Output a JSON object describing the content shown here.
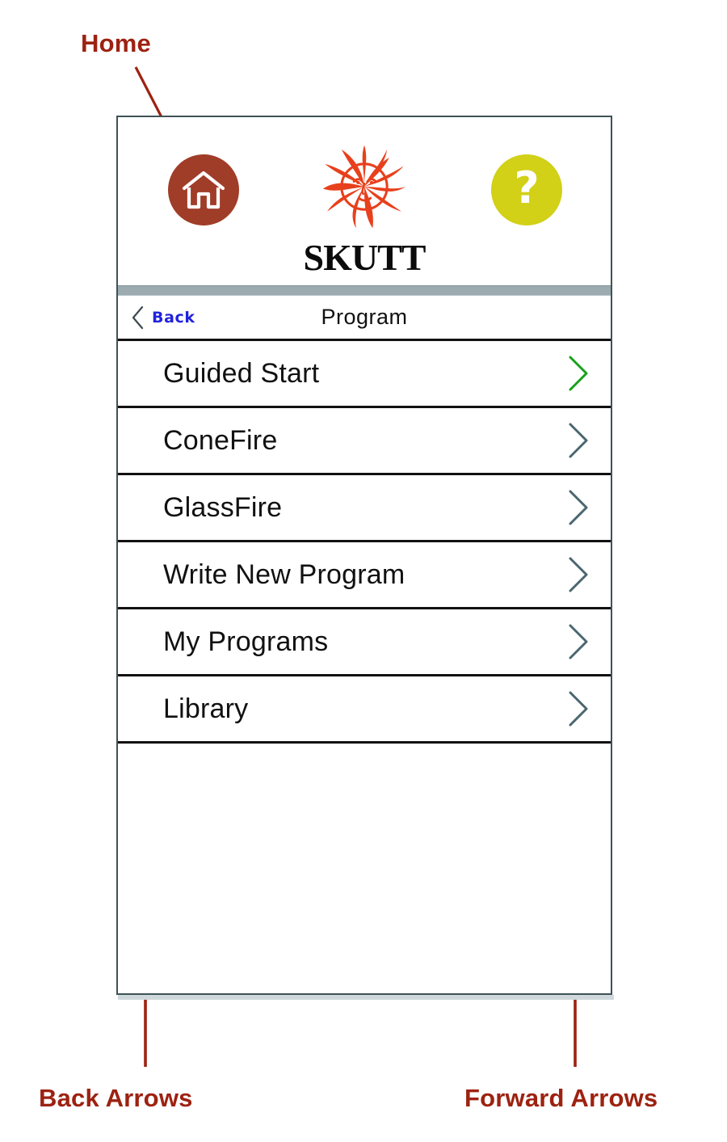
{
  "annotations": {
    "home": "Home",
    "back_arrows": "Back Arrows",
    "forward_arrows": "Forward Arrows",
    "color": "#9D2211"
  },
  "device": {
    "header": {
      "home_button": {
        "icon": "home-icon",
        "color": "#A03D28"
      },
      "help_button": {
        "icon": "question-mark-icon",
        "glyph": "?",
        "color": "#D2D017"
      },
      "logo": {
        "mark": "skutt-sun-icon",
        "mark_color": "#E8401C",
        "wordmark": "SKUTT"
      }
    },
    "nav": {
      "back_label": "Back",
      "back_color": "#2222DD",
      "back_icon": "chevron-left-icon",
      "title": "Program"
    },
    "menu": {
      "items": [
        {
          "label": "Guided Start",
          "chevron": "chevron-right-icon",
          "chevron_color": "#17A01A"
        },
        {
          "label": "ConeFire",
          "chevron": "chevron-right-icon",
          "chevron_color": "#4A6670"
        },
        {
          "label": "GlassFire",
          "chevron": "chevron-right-icon",
          "chevron_color": "#4A6670"
        },
        {
          "label": "Write New Program",
          "chevron": "chevron-right-icon",
          "chevron_color": "#4A6670"
        },
        {
          "label": "My Programs",
          "chevron": "chevron-right-icon",
          "chevron_color": "#4A6670"
        },
        {
          "label": "Library",
          "chevron": "chevron-right-icon",
          "chevron_color": "#4A6670"
        }
      ]
    }
  }
}
